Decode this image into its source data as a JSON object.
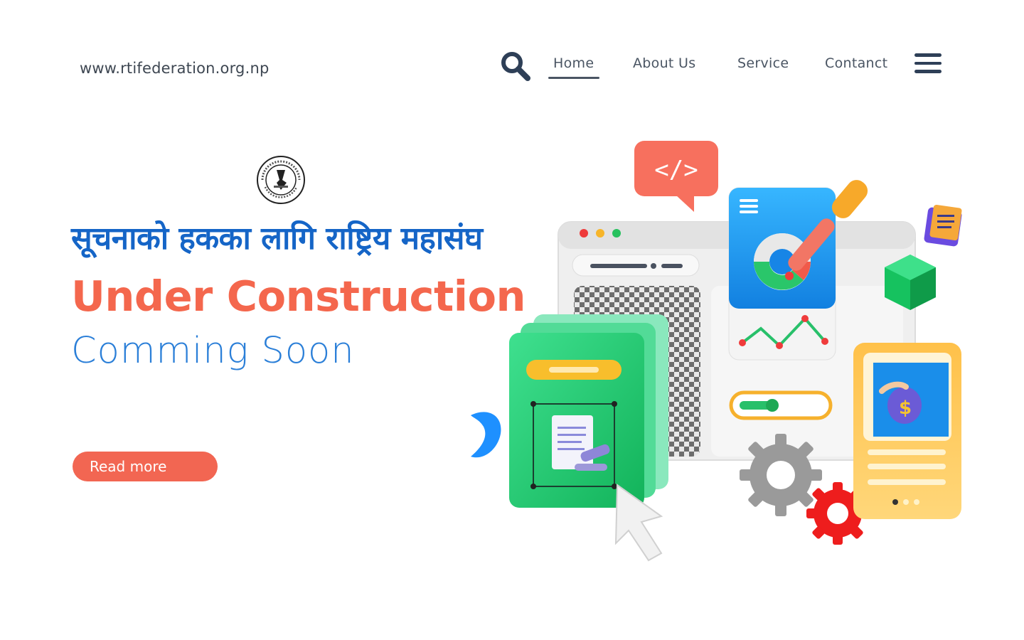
{
  "header": {
    "site_url": "www.rtifederation.org.np",
    "nav": [
      {
        "label": "Home",
        "active": true
      },
      {
        "label": "About Us",
        "active": false
      },
      {
        "label": "Service",
        "active": false
      },
      {
        "label": "Contanct",
        "active": false
      }
    ],
    "icons": [
      "search-icon",
      "menu-icon"
    ]
  },
  "hero": {
    "logo": "organization-seal",
    "nepali_title": "सूचनाको हकका लागि राष्ट्रिय महासंघ",
    "headline": "Under Construction",
    "subheadline": "Comming Soon",
    "cta_label": "Read more"
  },
  "illustration": {
    "code_badge": "</>"
  },
  "colors": {
    "accent": "#f26652",
    "headline": "#f4674d",
    "nepali_title": "#1565c7",
    "subheadline": "#2b7fd8",
    "nav_text": "#4a5563",
    "menu_icon": "#2e3f57"
  }
}
